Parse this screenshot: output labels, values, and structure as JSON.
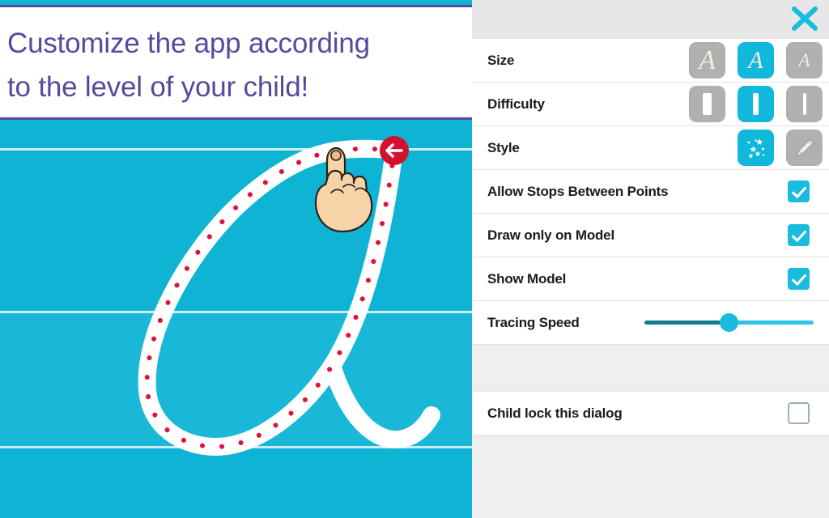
{
  "banner": {
    "line1": "Customize the app according",
    "line2": "to the level of your child!",
    "text_color": "#554b9e",
    "border_color": "#554b9e"
  },
  "canvas": {
    "background_color": "#0fb3d4",
    "band_color": "#19b8d8",
    "rule_color": "#cdeef7",
    "letter": "a",
    "letter_style": "cursive",
    "stroke_color": "#ffffff",
    "guide_dot_color": "#e0113c",
    "start_marker": {
      "name": "start-arrow-marker",
      "color": "#d4102f",
      "arrow_color": "#ffffff",
      "direction": "left"
    },
    "hand_cursor": {
      "name": "pointing-hand-cursor",
      "skin_color": "#f5ceаa"
    }
  },
  "panel": {
    "header": {
      "close_label": "✕",
      "close_color": "#19bcdd",
      "background": "#e7e7e7"
    },
    "accent_color": "#10b9db",
    "inactive_color": "#b0b0b0",
    "rows": [
      {
        "id": "size",
        "label": "Size",
        "type": "options",
        "options": [
          {
            "name": "size-large-option",
            "glyph": "A",
            "size": "big",
            "selected": false
          },
          {
            "name": "size-medium-option",
            "glyph": "A",
            "size": "mid",
            "selected": true
          },
          {
            "name": "size-small-option",
            "glyph": "A",
            "size": "sml",
            "selected": false
          }
        ]
      },
      {
        "id": "difficulty",
        "label": "Difficulty",
        "type": "options",
        "options": [
          {
            "name": "difficulty-easy-option",
            "glyph": "",
            "size": "w1",
            "selected": false
          },
          {
            "name": "difficulty-medium-option",
            "glyph": "",
            "size": "w2",
            "selected": true
          },
          {
            "name": "difficulty-hard-option",
            "glyph": "",
            "size": "w3",
            "selected": false
          }
        ]
      },
      {
        "id": "style",
        "label": "Style",
        "type": "options",
        "options": [
          {
            "name": "style-sparkles-option",
            "glyph": "sparkles-icon",
            "selected": true
          },
          {
            "name": "style-pencil-option",
            "glyph": "pencil-icon",
            "selected": false
          }
        ]
      },
      {
        "id": "allow-stops",
        "label": "Allow Stops Between Points",
        "type": "checkbox",
        "checked": true
      },
      {
        "id": "draw-only-on-model",
        "label": "Draw only on Model",
        "type": "checkbox",
        "checked": true
      },
      {
        "id": "show-model",
        "label": "Show Model",
        "type": "checkbox",
        "checked": true
      },
      {
        "id": "tracing-speed",
        "label": "Tracing Speed",
        "type": "slider",
        "value": 47,
        "min": 0,
        "max": 100
      }
    ],
    "footer_row": {
      "id": "child-lock",
      "label": "Child lock this dialog",
      "type": "checkbox",
      "checked": false
    }
  }
}
